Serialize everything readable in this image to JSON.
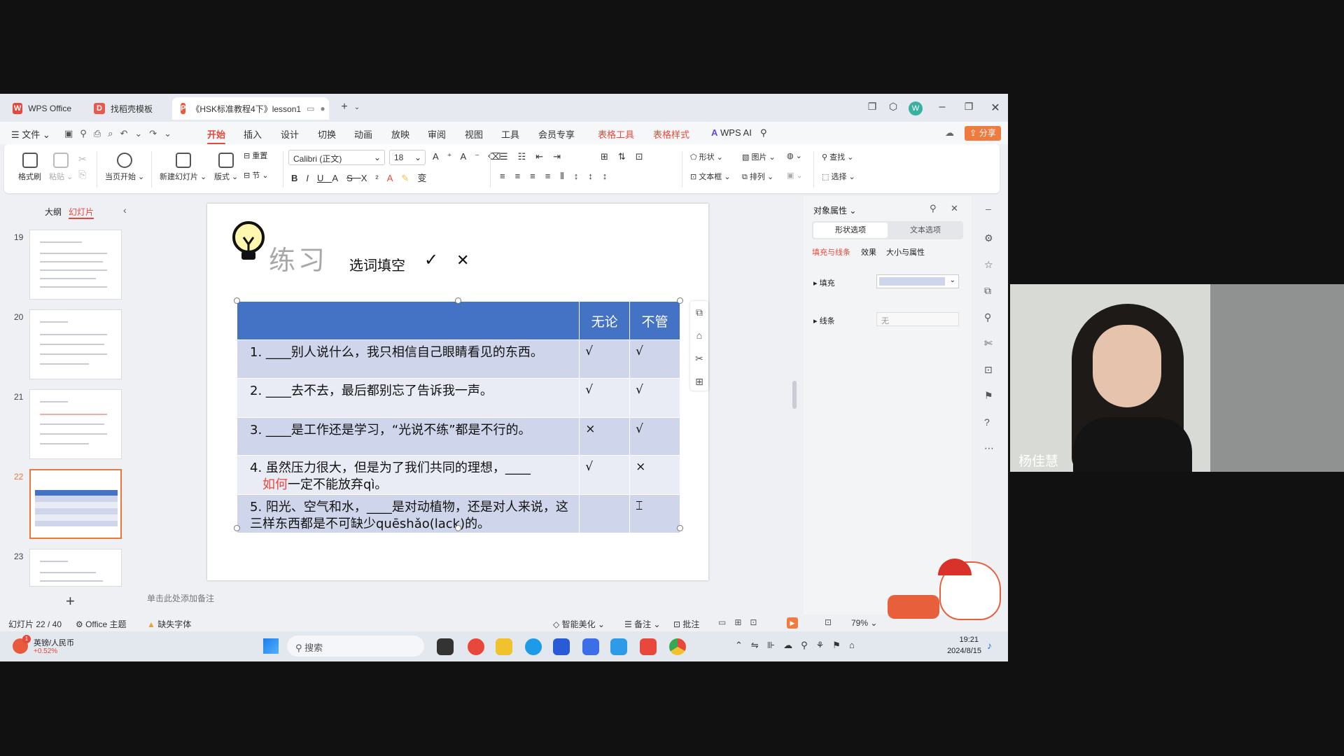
{
  "titlebar": {
    "tabs": [
      "WPS Office",
      "找稻壳模板",
      "《HSK标准教程4下》lesson1"
    ],
    "avatar_letter": "W"
  },
  "menubar": {
    "file": "文件",
    "items": [
      "开始",
      "插入",
      "设计",
      "切换",
      "动画",
      "放映",
      "审阅",
      "视图",
      "工具",
      "会员专享"
    ],
    "context_items": [
      "表格工具",
      "表格样式"
    ],
    "wps_ai": "WPS AI",
    "share": "分享"
  },
  "ribbon": {
    "format_painter": "格式刷",
    "paste": "粘贴",
    "start_current": "当页开始",
    "new_slide": "新建幻灯片",
    "layout": "版式",
    "section": "节",
    "reset": "重置",
    "font": "Calibri (正文)",
    "font_size": "18",
    "shape": "形状",
    "picture": "图片",
    "textbox": "文本框",
    "arrange": "排列",
    "find": "查找",
    "select": "选择"
  },
  "leftpanel": {
    "tab_outline": "大纲",
    "tab_slides": "幻灯片",
    "slide_numbers": [
      "19",
      "20",
      "21",
      "22",
      "23"
    ]
  },
  "slide": {
    "title": "练习",
    "subtitle": "选词填空",
    "check_mark": "✓",
    "cross_mark": "✕",
    "table_headers": [
      "无论",
      "不管"
    ],
    "rows": [
      {
        "q": "1. ____别人说什么，我只相信自己眼睛看见的东西。",
        "a": "√",
        "b": "√"
      },
      {
        "q": "2. ____去不去，最后都别忘了告诉我一声。",
        "a": "√",
        "b": "√"
      },
      {
        "q": "3. ____是工作还是学习，“光说不练”都是不行的。",
        "a": "×",
        "b": "√"
      },
      {
        "q_pre": "4. 虽然压力很大，但是为了我们共同的理想，____",
        "q_red": "如何",
        "q_post": "一定不能放弃qì。",
        "a": "√",
        "b": "×"
      },
      {
        "q": "5. 阳光、空气和水，____是对动植物，还是对人来说，这三样东西都是不可缺少quēshǎo(lack)的。",
        "a": "",
        "b": ""
      }
    ],
    "notes_placeholder": "单击此处添加备注"
  },
  "rightpanel": {
    "title": "对象属性",
    "tab_shape": "形状选项",
    "tab_text": "文本选项",
    "subtabs": [
      "填充与线条",
      "效果",
      "大小与属性"
    ],
    "fill_label": "填充",
    "line_label": "线条",
    "line_value": "无"
  },
  "status": {
    "slide_pos": "幻灯片 22 / 40",
    "theme": "Office 主题",
    "missing_font": "缺失字体",
    "smart": "智能美化",
    "notes": "备注",
    "comment": "批注",
    "zoom": "79%"
  },
  "taskbar": {
    "currency": "英镑/人民币",
    "change": "+0.52%",
    "badge": "1",
    "search": "搜索",
    "time": "19:21",
    "date": "2024/8/15"
  },
  "webcam": {
    "name": "杨佳慧"
  },
  "colors": {
    "accent": "#e8483b",
    "table_header": "#4472c4",
    "row_dark": "#cfd5ea",
    "row_light": "#e9ebf5"
  }
}
